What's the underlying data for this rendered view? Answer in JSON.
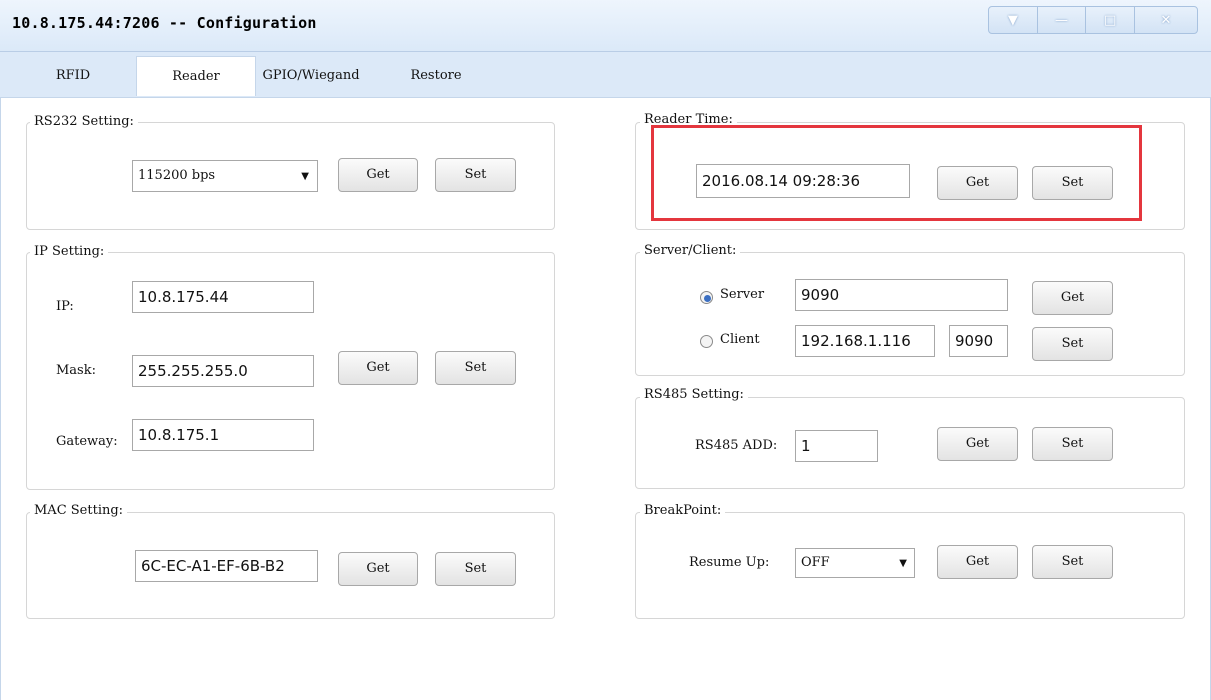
{
  "window": {
    "title": "10.8.175.44:7206 -- Configuration",
    "controls": [
      "minimize-to-tray",
      "minimize",
      "maximize",
      "close"
    ]
  },
  "tabs": [
    {
      "label": "RFID",
      "active": false
    },
    {
      "label": "Reader",
      "active": true
    },
    {
      "label": "GPIO/Wiegand",
      "active": false
    },
    {
      "label": "Restore",
      "active": false
    }
  ],
  "rs232": {
    "title": "RS232 Setting:",
    "baud_value": "115200 bps",
    "get_label": "Get",
    "set_label": "Set"
  },
  "ip": {
    "title": "IP Setting:",
    "ip_label": "IP:",
    "ip_value": "10.8.175.44",
    "mask_label": "Mask:",
    "mask_value": "255.255.255.0",
    "gateway_label": "Gateway:",
    "gateway_value": "10.8.175.1",
    "get_label": "Get",
    "set_label": "Set"
  },
  "mac": {
    "title": "MAC Setting:",
    "mac_value": "6C-EC-A1-EF-6B-B2",
    "get_label": "Get",
    "set_label": "Set"
  },
  "reader_time": {
    "title": "Reader Time:",
    "time_value": "2016.08.14 09:28:36",
    "get_label": "Get",
    "set_label": "Set",
    "highlight_color": "#e4363e"
  },
  "server_client": {
    "title": "Server/Client:",
    "server_label": "Server",
    "server_selected": true,
    "server_port": "9090",
    "client_label": "Client",
    "client_selected": false,
    "client_ip": "192.168.1.116",
    "client_port": "9090",
    "get_label": "Get",
    "set_label": "Set"
  },
  "rs485": {
    "title": "RS485 Setting:",
    "add_label": "RS485 ADD:",
    "add_value": "1",
    "get_label": "Get",
    "set_label": "Set"
  },
  "breakpoint": {
    "title": "BreakPoint:",
    "resume_label": "Resume Up:",
    "resume_value": "OFF",
    "get_label": "Get",
    "set_label": "Set"
  }
}
